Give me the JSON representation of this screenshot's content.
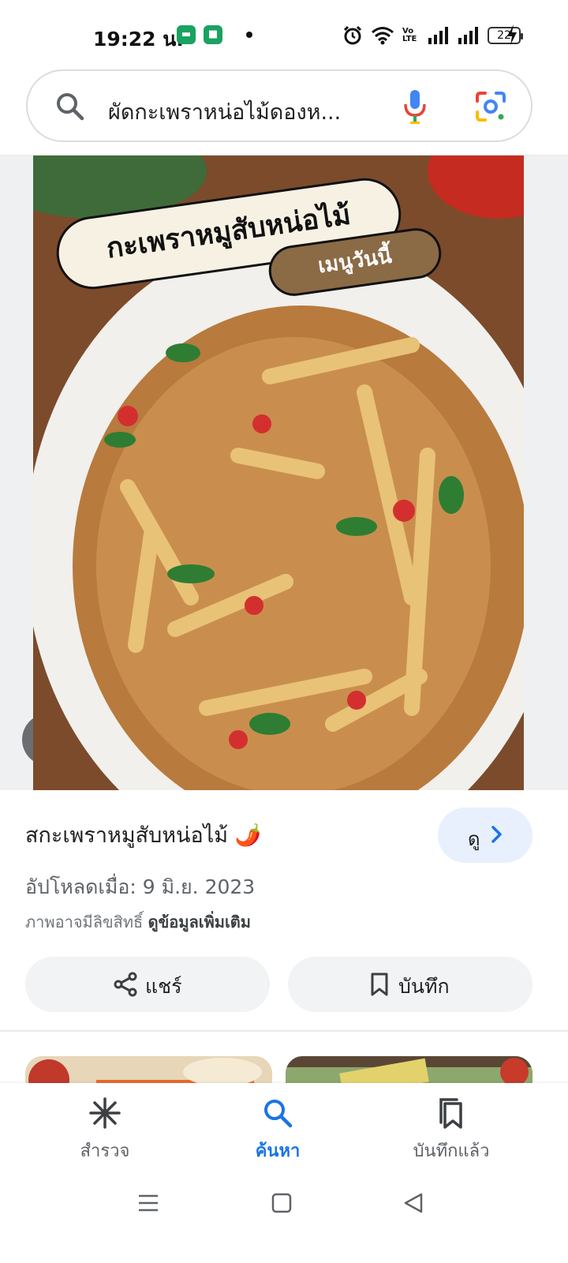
{
  "status_bar": {
    "time": "19:22 น.",
    "app_icon_1": "chat-icon",
    "app_icon_2": "line-icon",
    "volte": "Vo LTE",
    "battery": "22",
    "icons": [
      "alarm-icon",
      "wifi-icon",
      "signal-icon",
      "signal-icon",
      "battery-icon",
      "charging-icon"
    ]
  },
  "search": {
    "query": "ผัดกะเพราหน่อไม้ดองห...",
    "icons": [
      "search-icon",
      "mic-icon",
      "lens-icon"
    ]
  },
  "image": {
    "overlay_title": "กะเพราหมูสับหน่อไม้",
    "overlay_subtitle": "เมนูวันนี้"
  },
  "result": {
    "title": "สกะเพราหมูสับหน่อไม้ 🌶️",
    "view_label": "ดู",
    "upload_date": "อัปโหลดเมื่อ: 9 มิ.ย. 2023",
    "copyright_text": "ภาพอาจมีลิขสิทธิ์",
    "more_info_link": "ดูข้อมูลเพิ่มเติม"
  },
  "actions": {
    "share_label": "แชร์",
    "save_label": "บันทึก"
  },
  "bottom_nav": {
    "items": [
      {
        "label": "สำรวจ",
        "icon": "asterisk-icon",
        "active": false
      },
      {
        "label": "ค้นหา",
        "icon": "search-icon",
        "active": true
      },
      {
        "label": "บันทึกแล้ว",
        "icon": "saved-icon",
        "active": false
      }
    ]
  },
  "system_nav": {
    "icons": [
      "menu-icon",
      "home-icon",
      "back-icon"
    ]
  },
  "colors": {
    "accent": "#1a73e8",
    "view_button_bg": "#e8f0fe",
    "action_button_bg": "#f1f3f4"
  }
}
